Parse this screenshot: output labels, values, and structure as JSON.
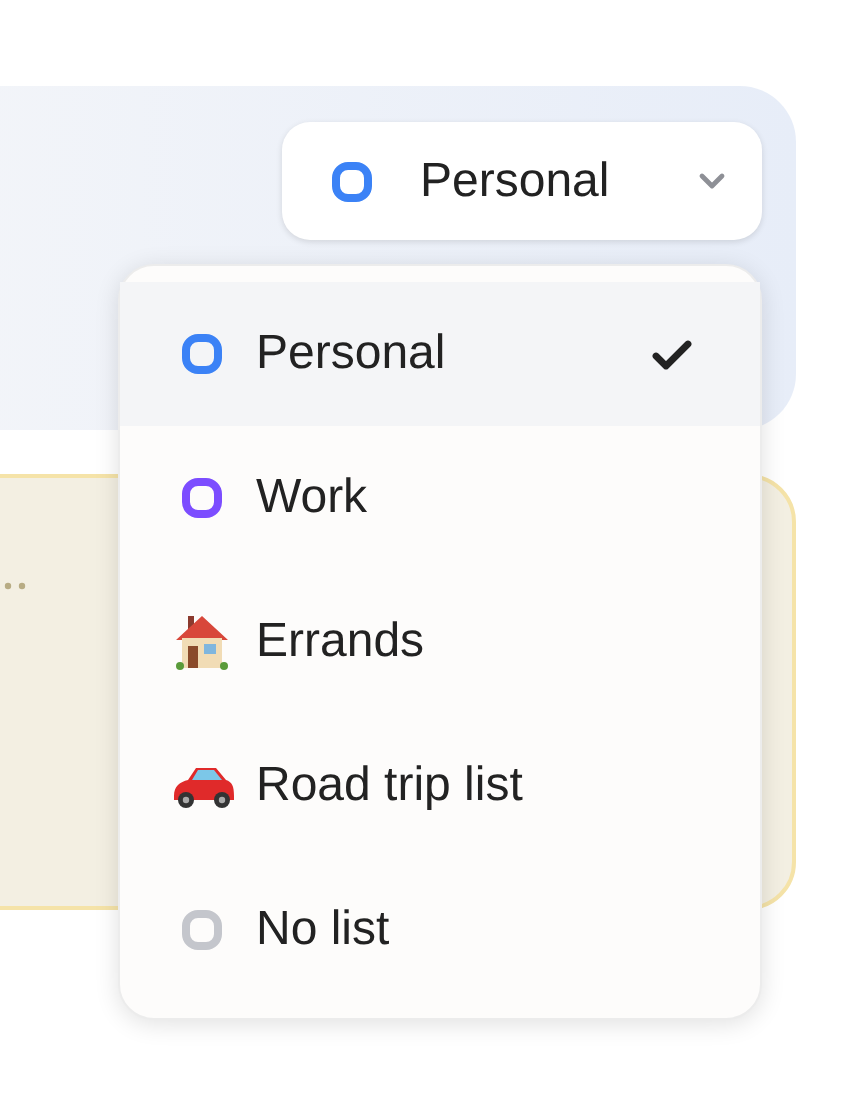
{
  "list_picker": {
    "label": "Personal",
    "color": "#3b82f6",
    "expanded": true
  },
  "menu_items": [
    {
      "label": "Personal",
      "kind": "ring",
      "color": "#3b82f6",
      "selected": true
    },
    {
      "label": "Work",
      "kind": "ring",
      "color": "#7c4dff",
      "selected": false
    },
    {
      "label": "Errands",
      "kind": "house",
      "selected": false
    },
    {
      "label": "Road trip list",
      "kind": "car",
      "selected": false
    },
    {
      "label": "No list",
      "kind": "ring",
      "color": "#c4c6cc",
      "selected": false
    }
  ]
}
